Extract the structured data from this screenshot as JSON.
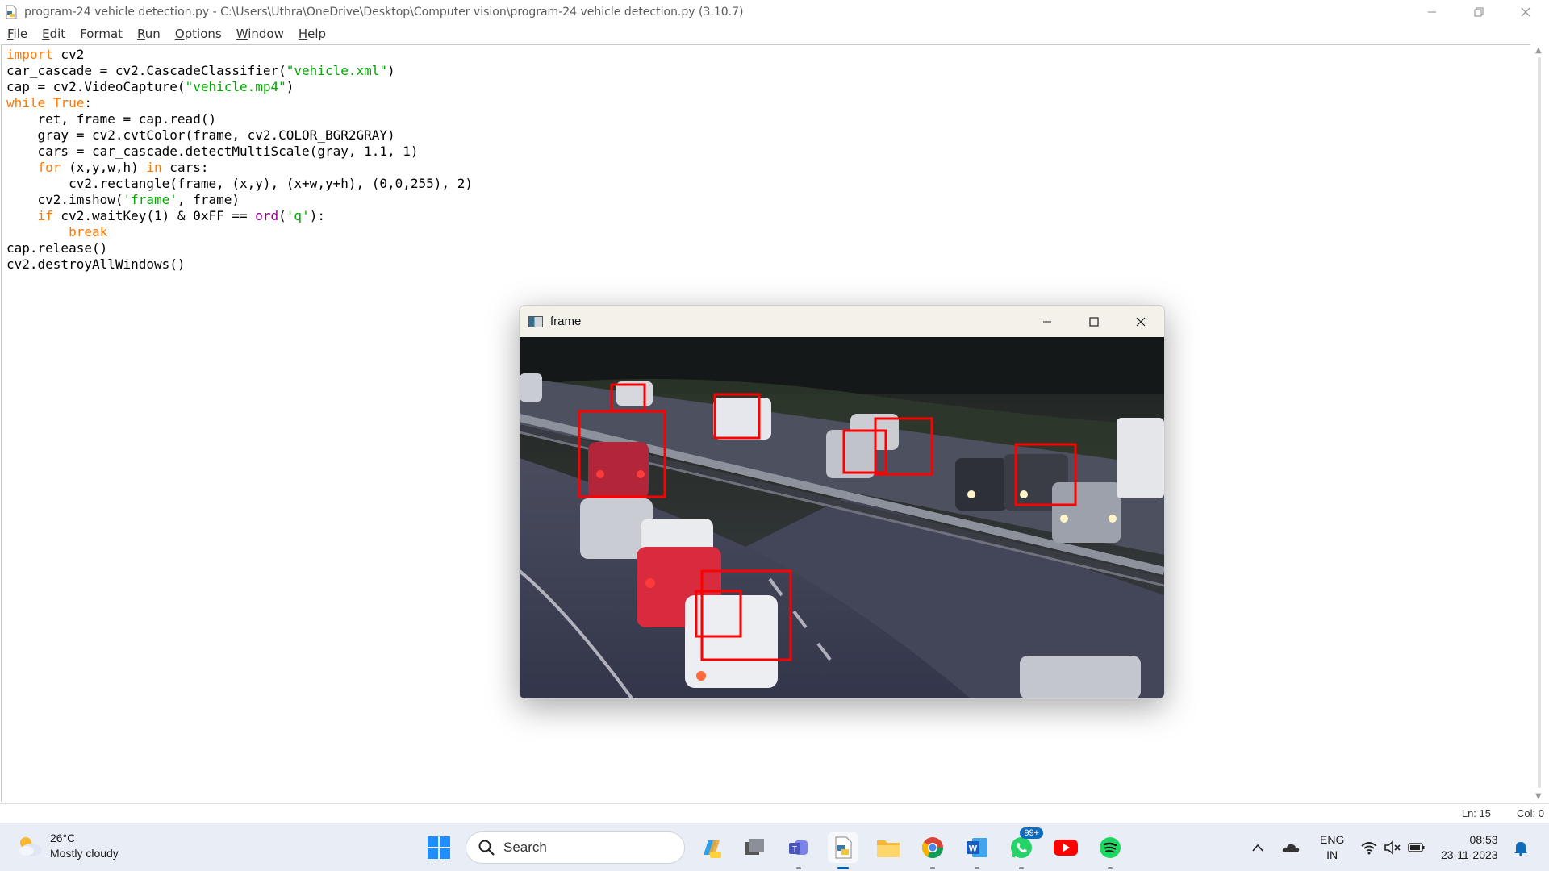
{
  "window": {
    "title": "program-24 vehicle detection.py - C:\\Users\\Uthra\\OneDrive\\Desktop\\Computer vision\\program-24 vehicle detection.py (3.10.7)"
  },
  "menu": [
    {
      "label": "File",
      "u": "F",
      "rest": "ile"
    },
    {
      "label": "Edit",
      "u": "E",
      "rest": "dit"
    },
    {
      "label": "Format",
      "u": "F",
      "rest": "ormat",
      "pre": ""
    },
    {
      "label": "Run",
      "u": "R",
      "rest": "un"
    },
    {
      "label": "Options",
      "u": "O",
      "rest": "ptions"
    },
    {
      "label": "Window",
      "u": "W",
      "rest": "indow"
    },
    {
      "label": "Help",
      "u": "H",
      "rest": "elp"
    }
  ],
  "code_lines": [
    "import cv2",
    "car_cascade = cv2.CascadeClassifier(\"vehicle.xml\")",
    "cap = cv2.VideoCapture(\"vehicle.mp4\")",
    "while True:",
    "    ret, frame = cap.read()",
    "    gray = cv2.cvtColor(frame, cv2.COLOR_BGR2GRAY)",
    "    cars = car_cascade.detectMultiScale(gray, 1.1, 1)",
    "    for (x,y,w,h) in cars:",
    "        cv2.rectangle(frame, (x,y), (x+w,y+h), (0,0,255), 2)",
    "    cv2.imshow('frame', frame)",
    "    if cv2.waitKey(1) & 0xFF == ord('q'):",
    "        break",
    "cap.release()",
    "cv2.destroyAllWindows()"
  ],
  "status": {
    "line": "Ln: 15",
    "col": "Col: 0"
  },
  "frame_window": {
    "title": "frame"
  },
  "taskbar": {
    "weather_temp": "26°C",
    "weather_desc": "Mostly cloudy",
    "search_placeholder": "Search",
    "whatsapp_badge": "99+",
    "lang_line1": "ENG",
    "lang_line2": "IN",
    "time": "08:53",
    "date": "23-11-2023"
  },
  "colors": {
    "keyword": "#ff7700",
    "string": "#00aa00",
    "builtin": "#900090",
    "detection_box": "#ff0000",
    "taskbar_bg": "#e9eef6"
  }
}
